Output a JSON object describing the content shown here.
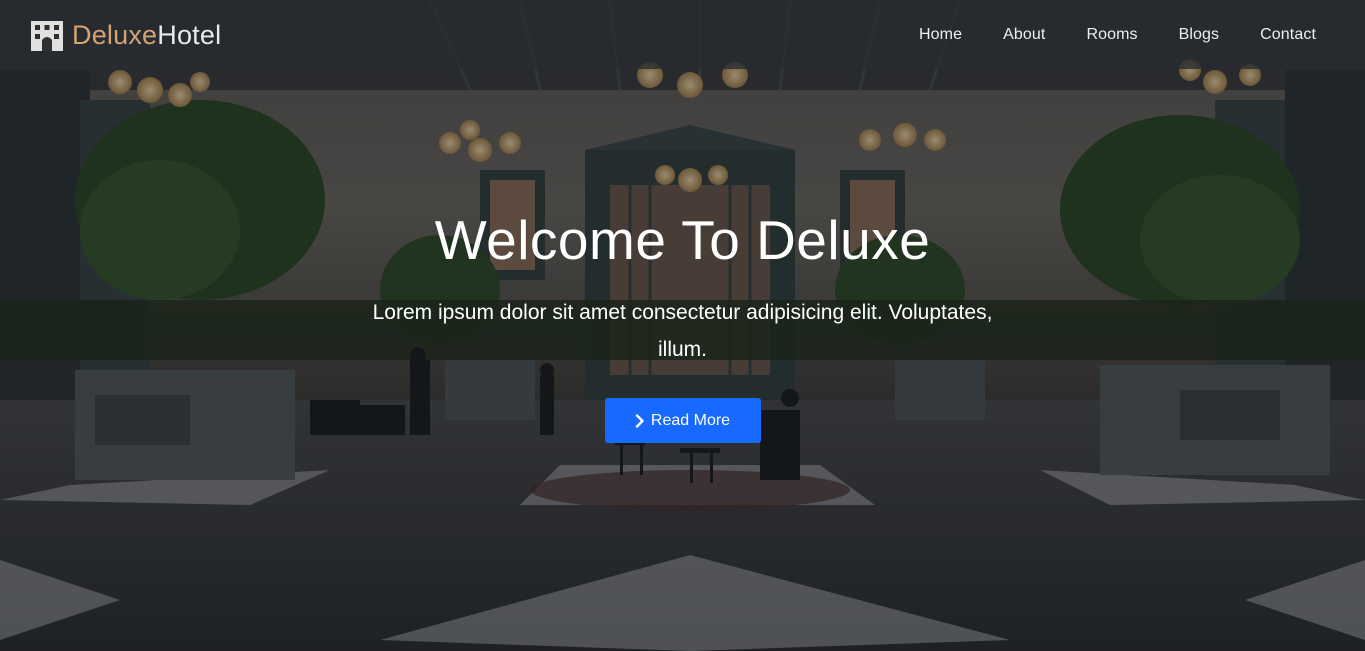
{
  "colors": {
    "brand_accent": "#d4a373",
    "brand_text": "#e9e9e9",
    "button_bg": "#1769ff",
    "nav_bg": "rgba(40,44,48,0.78)"
  },
  "navbar": {
    "brand": {
      "icon": "hotel-building-icon",
      "accent": "Deluxe",
      "rest": "Hotel"
    },
    "items": [
      {
        "label": "Home"
      },
      {
        "label": "About"
      },
      {
        "label": "Rooms"
      },
      {
        "label": "Blogs"
      },
      {
        "label": "Contact"
      }
    ]
  },
  "hero": {
    "title": "Welcome To Deluxe",
    "subtitle": "Lorem ipsum dolor sit amet consectetur adipisicing elit. Voluptates, illum.",
    "button": {
      "icon": "chevron-right-icon",
      "label": "Read More"
    }
  }
}
